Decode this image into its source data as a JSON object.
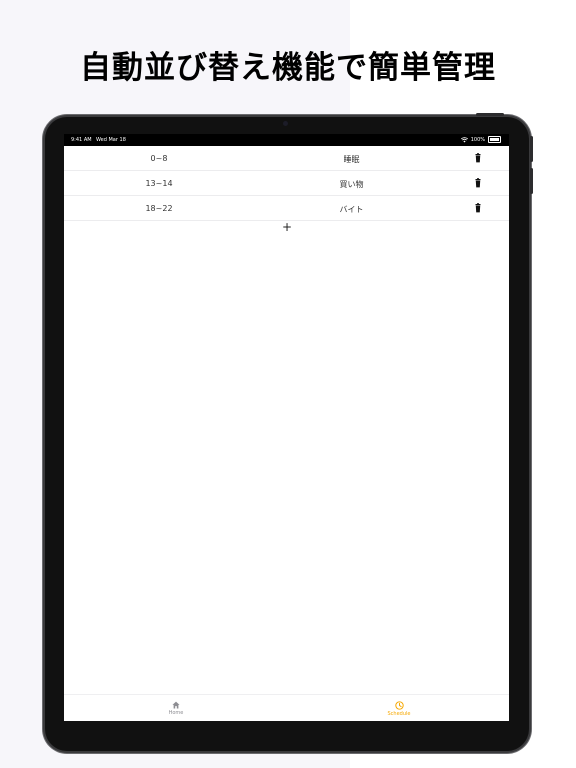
{
  "headline": "自動並び替え機能で簡単管理",
  "status_bar": {
    "time": "9:41 AM",
    "date": "Wed Mar 18",
    "battery": "100%"
  },
  "schedule": [
    {
      "time": "0~8",
      "task": "睡眠"
    },
    {
      "time": "13~14",
      "task": "買い物"
    },
    {
      "time": "18~22",
      "task": "バイト"
    }
  ],
  "add_button": "+",
  "tabs": [
    {
      "label": "Home",
      "icon": "house-icon",
      "active": false
    },
    {
      "label": "Schedule",
      "icon": "clock-icon",
      "active": true
    }
  ],
  "colors": {
    "accent": "#f6a800",
    "inactive_tab": "#8e8e93"
  }
}
